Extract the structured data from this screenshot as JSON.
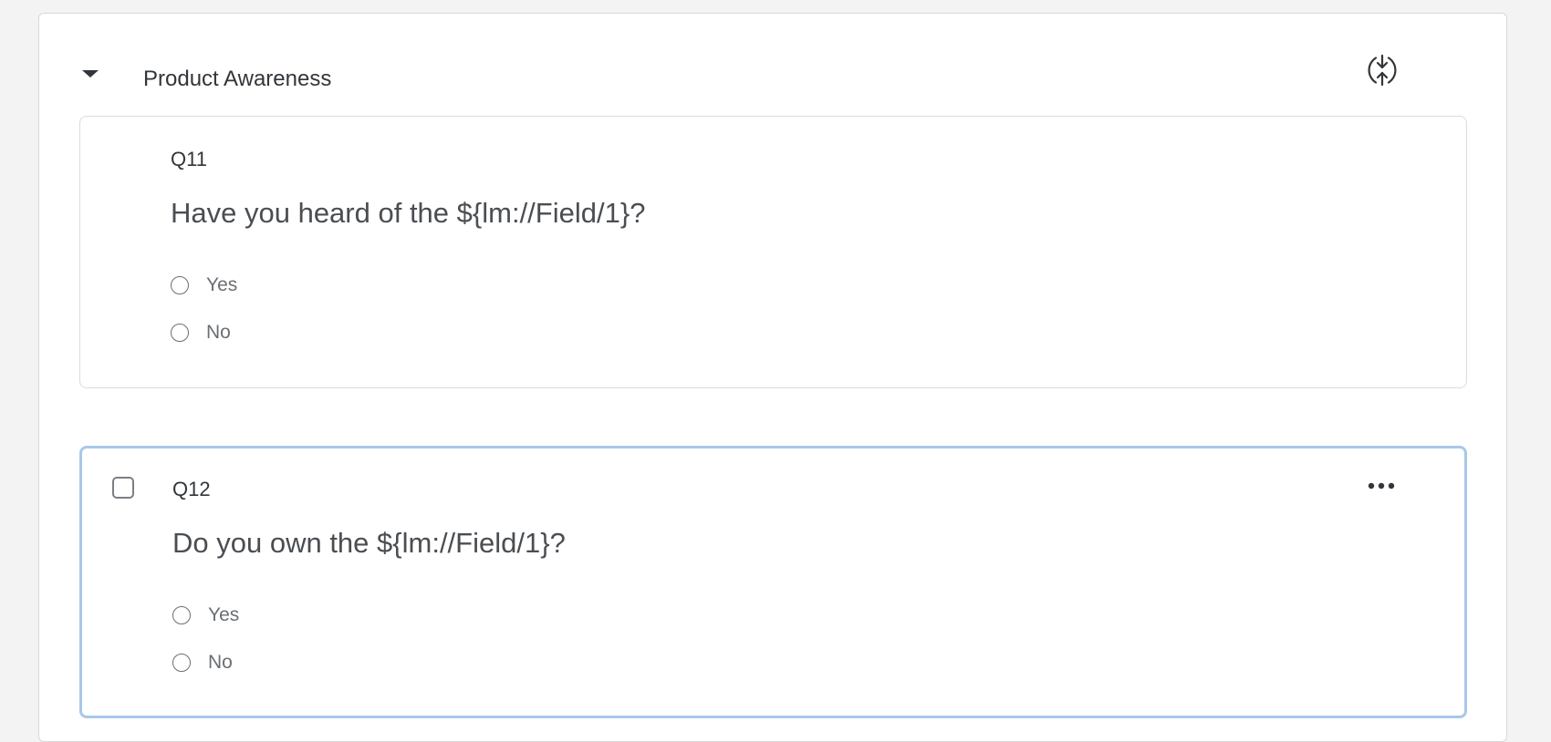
{
  "block": {
    "title": "Product Awareness",
    "collapse_icon": "caret-down-icon",
    "loop_icon": "loop-and-merge-icon"
  },
  "questions": [
    {
      "label": "Q11",
      "text": "Have you heard of the ${lm://Field/1}?",
      "selected": false,
      "choices": [
        "Yes",
        "No"
      ]
    },
    {
      "label": "Q12",
      "text": "Do you own the ${lm://Field/1}?",
      "selected": true,
      "choices": [
        "Yes",
        "No"
      ],
      "more_icon": "more-options-icon"
    }
  ],
  "colors": {
    "selected_border": "#a8c8ea",
    "text": "#32363a",
    "page_bg": "#f3f3f3"
  }
}
